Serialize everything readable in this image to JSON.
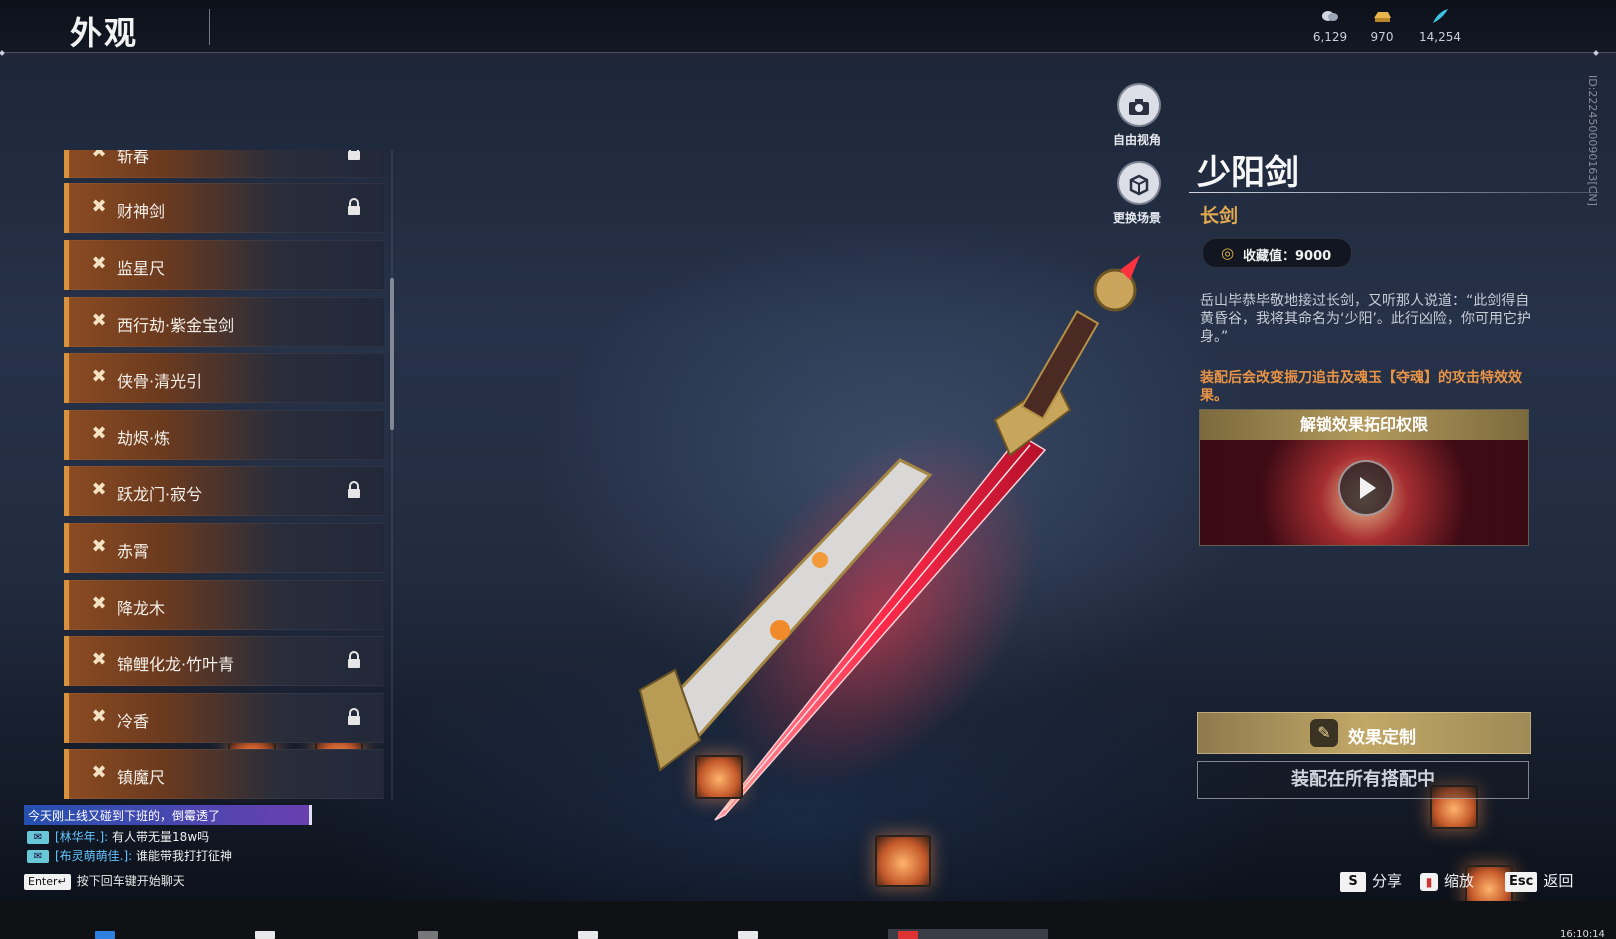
{
  "header": {
    "title": "外观",
    "currencies": [
      {
        "icon": "silver-coin-icon",
        "value": "6,129"
      },
      {
        "icon": "gold-ingot-icon",
        "value": "970"
      },
      {
        "icon": "jade-feather-icon",
        "value": "14,254"
      }
    ]
  },
  "list": {
    "items": [
      {
        "label": "斩春",
        "locked": true
      },
      {
        "label": "财神剑",
        "locked": true
      },
      {
        "label": "监星尺",
        "locked": false
      },
      {
        "label": "西行劫·紫金宝剑",
        "locked": false
      },
      {
        "label": "侠骨·清光引",
        "locked": false
      },
      {
        "label": "劫烬·炼",
        "locked": false
      },
      {
        "label": "跃龙门·寂兮",
        "locked": true
      },
      {
        "label": "赤霄",
        "locked": false
      },
      {
        "label": "降龙木",
        "locked": false
      },
      {
        "label": "锦鲤化龙·竹叶青",
        "locked": true
      },
      {
        "label": "冷香",
        "locked": true
      },
      {
        "label": "镇魔尺",
        "locked": false
      }
    ]
  },
  "camera": {
    "free_view_label": "自由视角",
    "change_scene_label": "更换场景"
  },
  "detail": {
    "name": "少阳剑",
    "type": "长剑",
    "collect_label": "收藏值：9000",
    "description": "岳山毕恭毕敬地接过长剑，又听那人说道：“此剑得自黄昏谷，我将其命名为‘少阳’。此行凶险，你可用它护身。”",
    "effect_note": "装配后会改变振刀追击及魂玉【夺魂】的攻击特效效果。",
    "unlock_title": "解锁效果拓印权限",
    "custom_button": "效果定制",
    "equip_button": "装配在所有搭配中",
    "player_id": "ID:2224500090163[CN]"
  },
  "chat": {
    "highlight": "今天刚上线又碰到下班的，倒霉透了",
    "lines": [
      {
        "name": "[林华年.]:",
        "text": " 有人带无量18w吗"
      },
      {
        "name": "[布灵萌萌佳.]:",
        "text": " 谁能带我打打征神"
      }
    ],
    "enter_key": "Enter↵",
    "hint": "按下回车键开始聊天"
  },
  "hints": {
    "share_key": "S",
    "share_label": "分享",
    "zoom_label": "缩放",
    "back_key": "Esc",
    "back_label": "返回"
  },
  "taskbar": {
    "clock": "16:10:14"
  },
  "colors": {
    "accent_gold": "#e3a94f",
    "accent_orange": "#e99346",
    "list_border": "#d9913b"
  }
}
